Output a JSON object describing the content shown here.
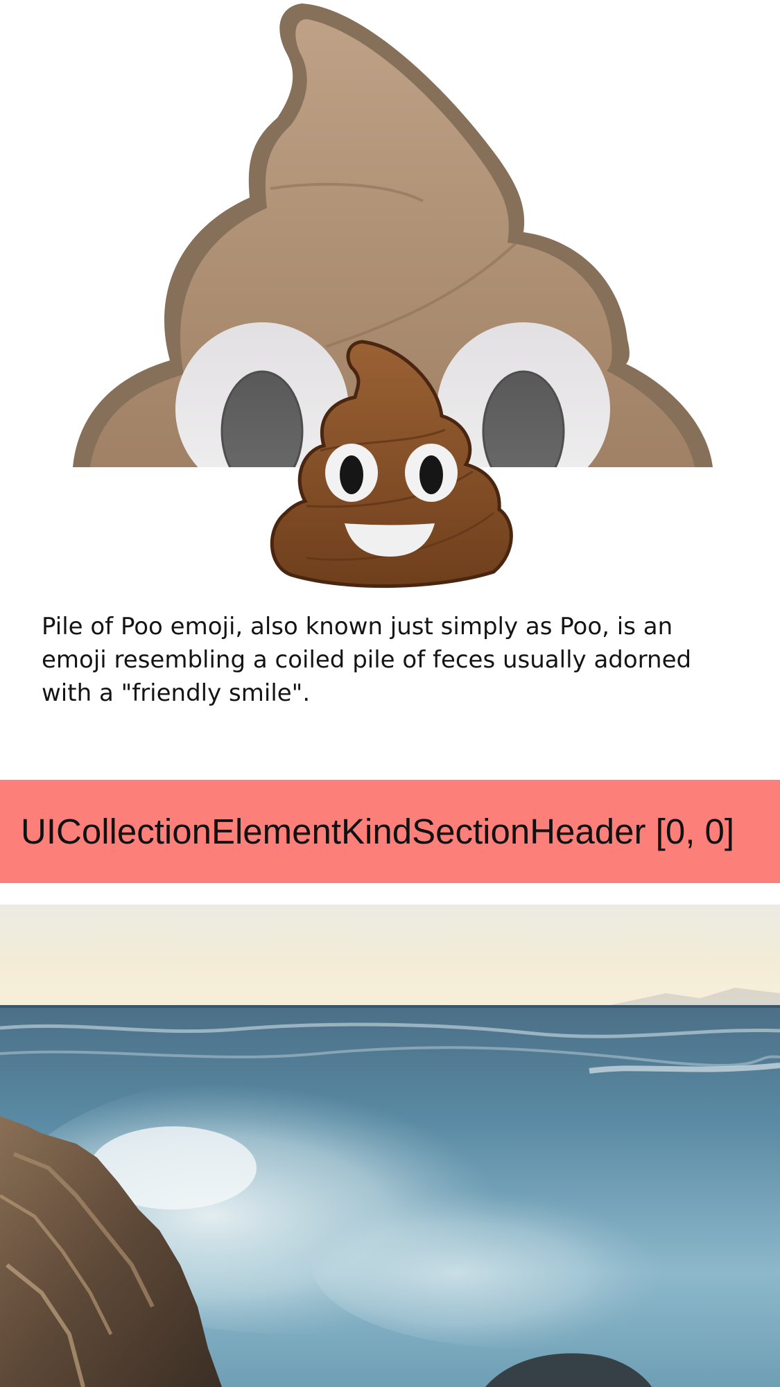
{
  "item_cell": {
    "banner_image": "pile-of-poo-emoji-large-crop",
    "badge_image": "pile-of-poo-emoji",
    "caption": "Pile of Poo emoji, also known just simply as Poo, is an emoji resembling a coiled pile of feces usually adorned with a \"friendly smile\"."
  },
  "section_header": {
    "title": "UICollectionElementKindSectionHeader [0, 0]",
    "background_color": "#fc7f7a"
  },
  "photo_cell": {
    "image": "ocean-waves-rocky-coast-photo"
  },
  "colors": {
    "background": "#ffffff",
    "poo_light": "#b5977a",
    "poo_outline": "#86705a",
    "emoji_brown": "#7b4a23"
  }
}
